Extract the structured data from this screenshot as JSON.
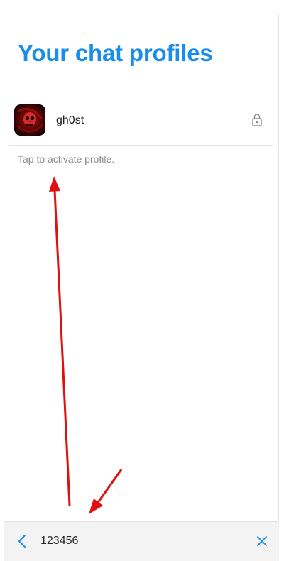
{
  "header": {
    "title": "Your chat profiles"
  },
  "profiles": [
    {
      "name": "gh0st",
      "avatar_icon": "skull-avatar",
      "status_icon": "lock-icon"
    }
  ],
  "hint": "Tap to activate profile.",
  "bottom_bar": {
    "back_icon": "chevron-left-icon",
    "input_value": "123456",
    "clear_icon": "close-icon"
  },
  "colors": {
    "accent": "#1a8de9",
    "annotation_arrow": "#e01010"
  }
}
